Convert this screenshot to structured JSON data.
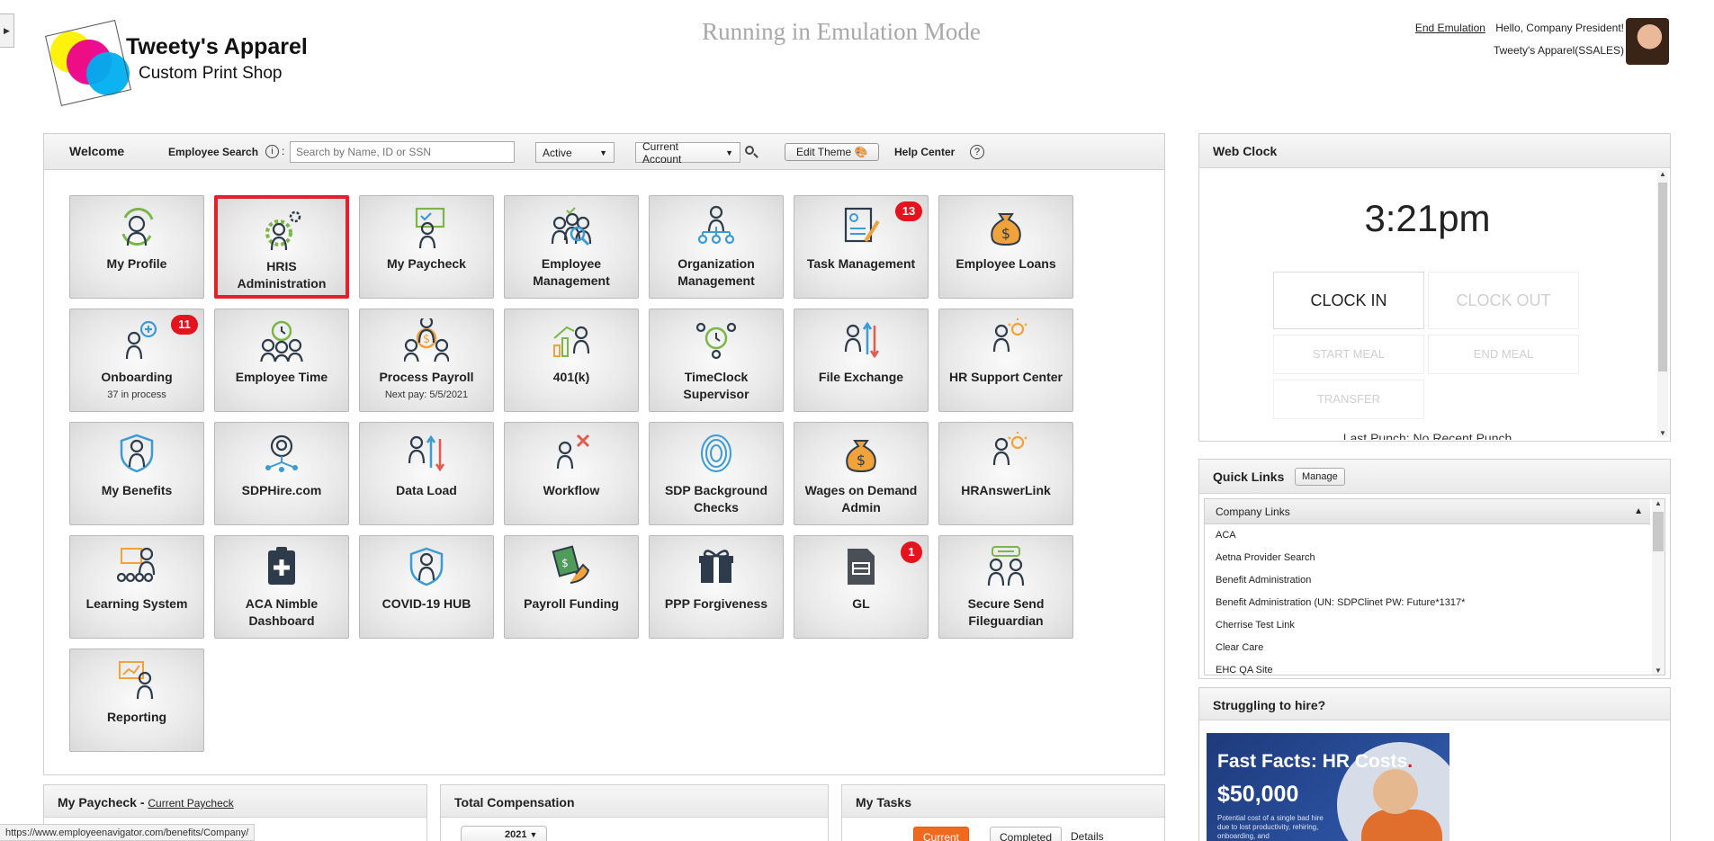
{
  "header": {
    "logo_line1": "Tweety's Apparel",
    "logo_line2": "Custom Print Shop",
    "emulation_banner": "Running in Emulation Mode",
    "end_emulation": "End Emulation",
    "greeting": "Hello, Company President!",
    "company": "Tweety's Apparel(SSALES)"
  },
  "toolbar": {
    "welcome": "Welcome",
    "employee_search_label": "Employee Search",
    "info_icon": "i",
    "search_placeholder": "Search by Name, ID or SSN",
    "status_value": "Active",
    "account_value": "Current Account",
    "edit_theme": "Edit Theme",
    "help_center": "Help Center",
    "help_icon": "?"
  },
  "tiles": [
    {
      "label": "My Profile",
      "sub": "",
      "badge": "",
      "icon": "profile-icon"
    },
    {
      "label": "HRIS Administration",
      "sub": "",
      "badge": "",
      "icon": "gear-person-icon"
    },
    {
      "label": "My Paycheck",
      "sub": "",
      "badge": "",
      "icon": "paycheck-icon"
    },
    {
      "label": "Employee Management",
      "sub": "",
      "badge": "",
      "icon": "team-search-icon"
    },
    {
      "label": "Organization Management",
      "sub": "",
      "badge": "",
      "icon": "org-chart-icon"
    },
    {
      "label": "Task Management",
      "sub": "",
      "badge": "13",
      "icon": "task-doc-icon"
    },
    {
      "label": "Employee Loans",
      "sub": "",
      "badge": "",
      "icon": "money-bag-icon"
    },
    {
      "label": "Onboarding",
      "sub": "37 in process",
      "badge": "11",
      "icon": "add-person-icon"
    },
    {
      "label": "Employee Time",
      "sub": "",
      "badge": "",
      "icon": "clock-team-icon"
    },
    {
      "label": "Process Payroll",
      "sub": "Next pay: 5/5/2021",
      "badge": "",
      "icon": "payroll-icon"
    },
    {
      "label": "401(k)",
      "sub": "",
      "badge": "",
      "icon": "growth-chart-icon"
    },
    {
      "label": "TimeClock Supervisor",
      "sub": "",
      "badge": "",
      "icon": "timeclock-icon"
    },
    {
      "label": "File Exchange",
      "sub": "",
      "badge": "",
      "icon": "exchange-arrows-icon"
    },
    {
      "label": "HR Support Center",
      "sub": "",
      "badge": "",
      "icon": "idea-person-icon"
    },
    {
      "label": "My Benefits",
      "sub": "",
      "badge": "",
      "icon": "shield-person-icon"
    },
    {
      "label": "SDPHire.com",
      "sub": "",
      "badge": "",
      "icon": "network-person-icon"
    },
    {
      "label": "Data Load",
      "sub": "",
      "badge": "",
      "icon": "upload-arrows-icon"
    },
    {
      "label": "Workflow",
      "sub": "",
      "badge": "",
      "icon": "workflow-tools-icon"
    },
    {
      "label": "SDP Background Checks",
      "sub": "",
      "badge": "",
      "icon": "fingerprint-icon"
    },
    {
      "label": "Wages on Demand Admin",
      "sub": "",
      "badge": "",
      "icon": "money-bag-icon"
    },
    {
      "label": "HRAnswerLink",
      "sub": "",
      "badge": "",
      "icon": "idea-person-icon"
    },
    {
      "label": "Learning System",
      "sub": "",
      "badge": "",
      "icon": "learning-board-icon"
    },
    {
      "label": "ACA Nimble Dashboard",
      "sub": "",
      "badge": "",
      "icon": "clipboard-cross-icon"
    },
    {
      "label": "COVID-19 HUB",
      "sub": "",
      "badge": "",
      "icon": "shield-person-icon"
    },
    {
      "label": "Payroll Funding",
      "sub": "",
      "badge": "",
      "icon": "cash-hand-icon"
    },
    {
      "label": "PPP Forgiveness",
      "sub": "",
      "badge": "",
      "icon": "gift-icon"
    },
    {
      "label": "GL",
      "sub": "",
      "badge": "1",
      "icon": "ledger-doc-icon"
    },
    {
      "label": "Secure Send Fileguardian",
      "sub": "",
      "badge": "",
      "icon": "secure-chat-icon"
    },
    {
      "label": "Reporting",
      "sub": "",
      "badge": "",
      "icon": "report-board-icon"
    }
  ],
  "webclock": {
    "title": "Web Clock",
    "time": "3:21pm",
    "clock_in": "CLOCK IN",
    "clock_out": "CLOCK OUT",
    "start_meal": "START MEAL",
    "end_meal": "END MEAL",
    "transfer": "TRANSFER",
    "cut_text": "Last Punch: No Recent Punch"
  },
  "quicklinks": {
    "title": "Quick Links",
    "manage": "Manage",
    "group": "Company Links",
    "items": [
      "ACA",
      "Aetna Provider Search",
      "Benefit Administration",
      "Benefit Administration (UN: SDPClinet PW: Future*1317*",
      "Cherrise Test Link",
      "Clear Care",
      "EHC QA Site"
    ]
  },
  "hire": {
    "title": "Struggling to hire?",
    "ad_title": "Fast Facts: HR Costs",
    "ad_dot": ".",
    "ad_amount": "$50,000",
    "ad_text": "Potential cost of a single bad hire due to lost productivity, rehiring, onboarding, and"
  },
  "bottom": {
    "paycheck_title": "My Paycheck - ",
    "current_paycheck": "Current Paycheck",
    "comp_title": "Total Compensation",
    "comp_year": "2021",
    "tasks_title": "My Tasks",
    "tab_current": "Current",
    "tab_completed": "Completed",
    "tab_details": "Details"
  },
  "status_bar": {
    "url": "https://www.employeenavigator.com/benefits/Company/"
  },
  "colors": {
    "selected_border": "#e3212c",
    "badge": "#e5131d",
    "icon_green": "#7ab648",
    "icon_blue": "#3a9bd5",
    "icon_orange": "#f0a23c",
    "icon_dark": "#2d3b4a",
    "tab_current": "#ef6a1f"
  }
}
